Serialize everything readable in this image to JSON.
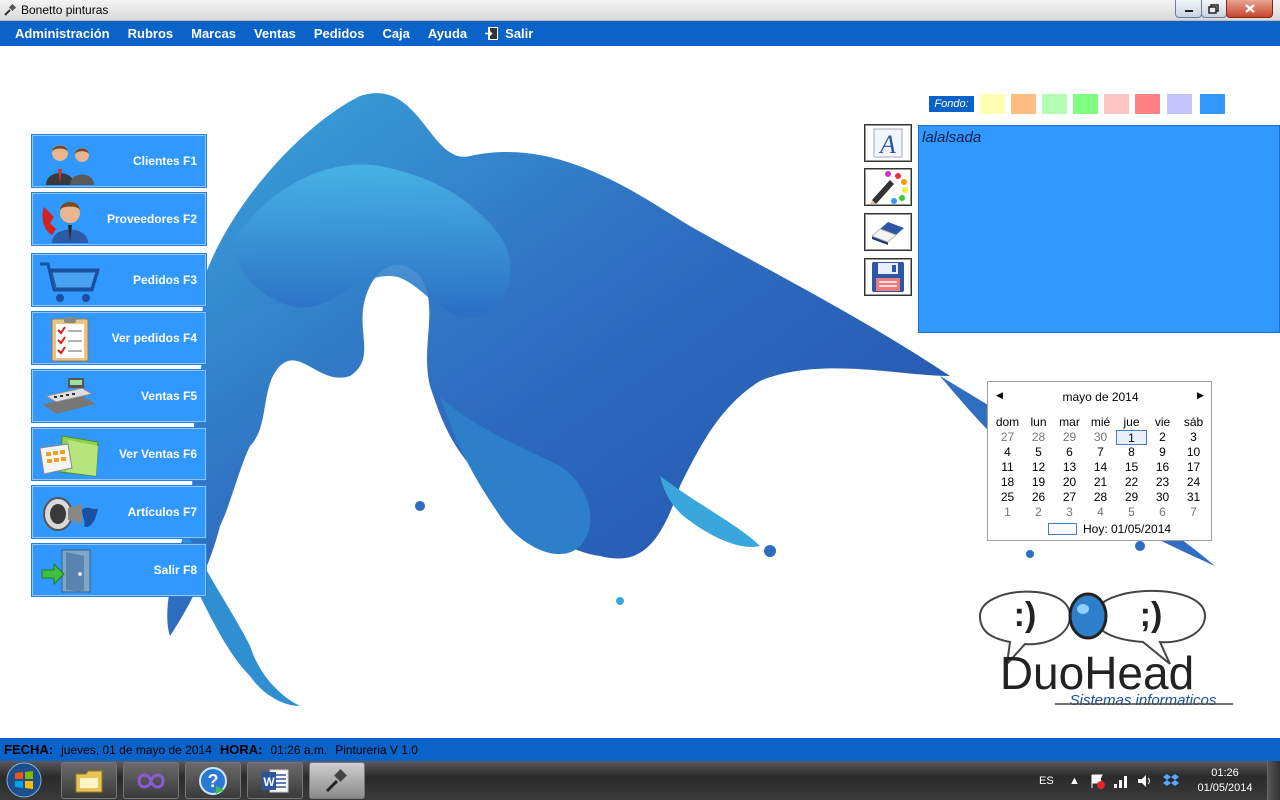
{
  "window": {
    "title": "Bonetto pinturas",
    "controls": [
      "minimize",
      "maximize",
      "close"
    ]
  },
  "menu": [
    {
      "label": "Administración"
    },
    {
      "label": "Rubros"
    },
    {
      "label": "Marcas"
    },
    {
      "label": "Ventas"
    },
    {
      "label": "Pedidos"
    },
    {
      "label": "Caja"
    },
    {
      "label": "Ayuda"
    },
    {
      "label": "Salir",
      "icon": "exit-door-icon"
    }
  ],
  "side_buttons": [
    {
      "label": "Clientes F1",
      "icon": "clients-icon"
    },
    {
      "label": "Proveedores F2",
      "icon": "supplier-phone-icon"
    },
    {
      "label": "Pedidos F3",
      "icon": "shopping-cart-icon"
    },
    {
      "label": "Ver pedidos F4",
      "icon": "clipboard-checklist-icon"
    },
    {
      "label": "Ventas F5",
      "icon": "cash-register-icon"
    },
    {
      "label": "Ver Ventas F6",
      "icon": "calculator-folder-icon"
    },
    {
      "label": "Artículos F7",
      "icon": "paint-spray-icon"
    },
    {
      "label": "Salir F8",
      "icon": "exit-door-icon"
    }
  ],
  "notes": {
    "fondo_label": "Fondo:",
    "swatches": [
      "#ffffb3",
      "#ffbb80",
      "#b3ffb3",
      "#80ff80",
      "#ffc4c4",
      "#ff8080",
      "#c4c4ff",
      "#3198ff"
    ],
    "tools": [
      "font-icon",
      "pencil-palette-icon",
      "eraser-icon",
      "save-disk-icon"
    ],
    "text": "lalalsada",
    "background": "#3198ff"
  },
  "calendar": {
    "month_label": "mayo de 2014",
    "weekdays": [
      "dom",
      "lun",
      "mar",
      "mié",
      "jue",
      "vie",
      "sáb"
    ],
    "weeks": [
      [
        "27",
        "28",
        "29",
        "30",
        "1",
        "2",
        "3"
      ],
      [
        "4",
        "5",
        "6",
        "7",
        "8",
        "9",
        "10"
      ],
      [
        "11",
        "12",
        "13",
        "14",
        "15",
        "16",
        "17"
      ],
      [
        "18",
        "19",
        "20",
        "21",
        "22",
        "23",
        "24"
      ],
      [
        "25",
        "26",
        "27",
        "28",
        "29",
        "30",
        "31"
      ],
      [
        "1",
        "2",
        "3",
        "4",
        "5",
        "6",
        "7"
      ]
    ],
    "today_label": "Hoy: 01/05/2014"
  },
  "logo": {
    "name": "DuoHead",
    "tagline": "Sistemas informaticos",
    "bubble_left": ":)",
    "bubble_right": ";)"
  },
  "statusbar": {
    "fecha_label": "FECHA:",
    "fecha_value": "jueves, 01 de mayo de 2014",
    "hora_label": "HORA:",
    "hora_value": "01:26 a.m.",
    "version": "Pintureria V 1.0"
  },
  "taskbar": {
    "apps": [
      "explorer-icon",
      "visual-studio-icon",
      "help-icon",
      "word-icon",
      "paint-app-icon"
    ],
    "language": "ES",
    "time": "01:26",
    "date": "01/05/2014"
  }
}
